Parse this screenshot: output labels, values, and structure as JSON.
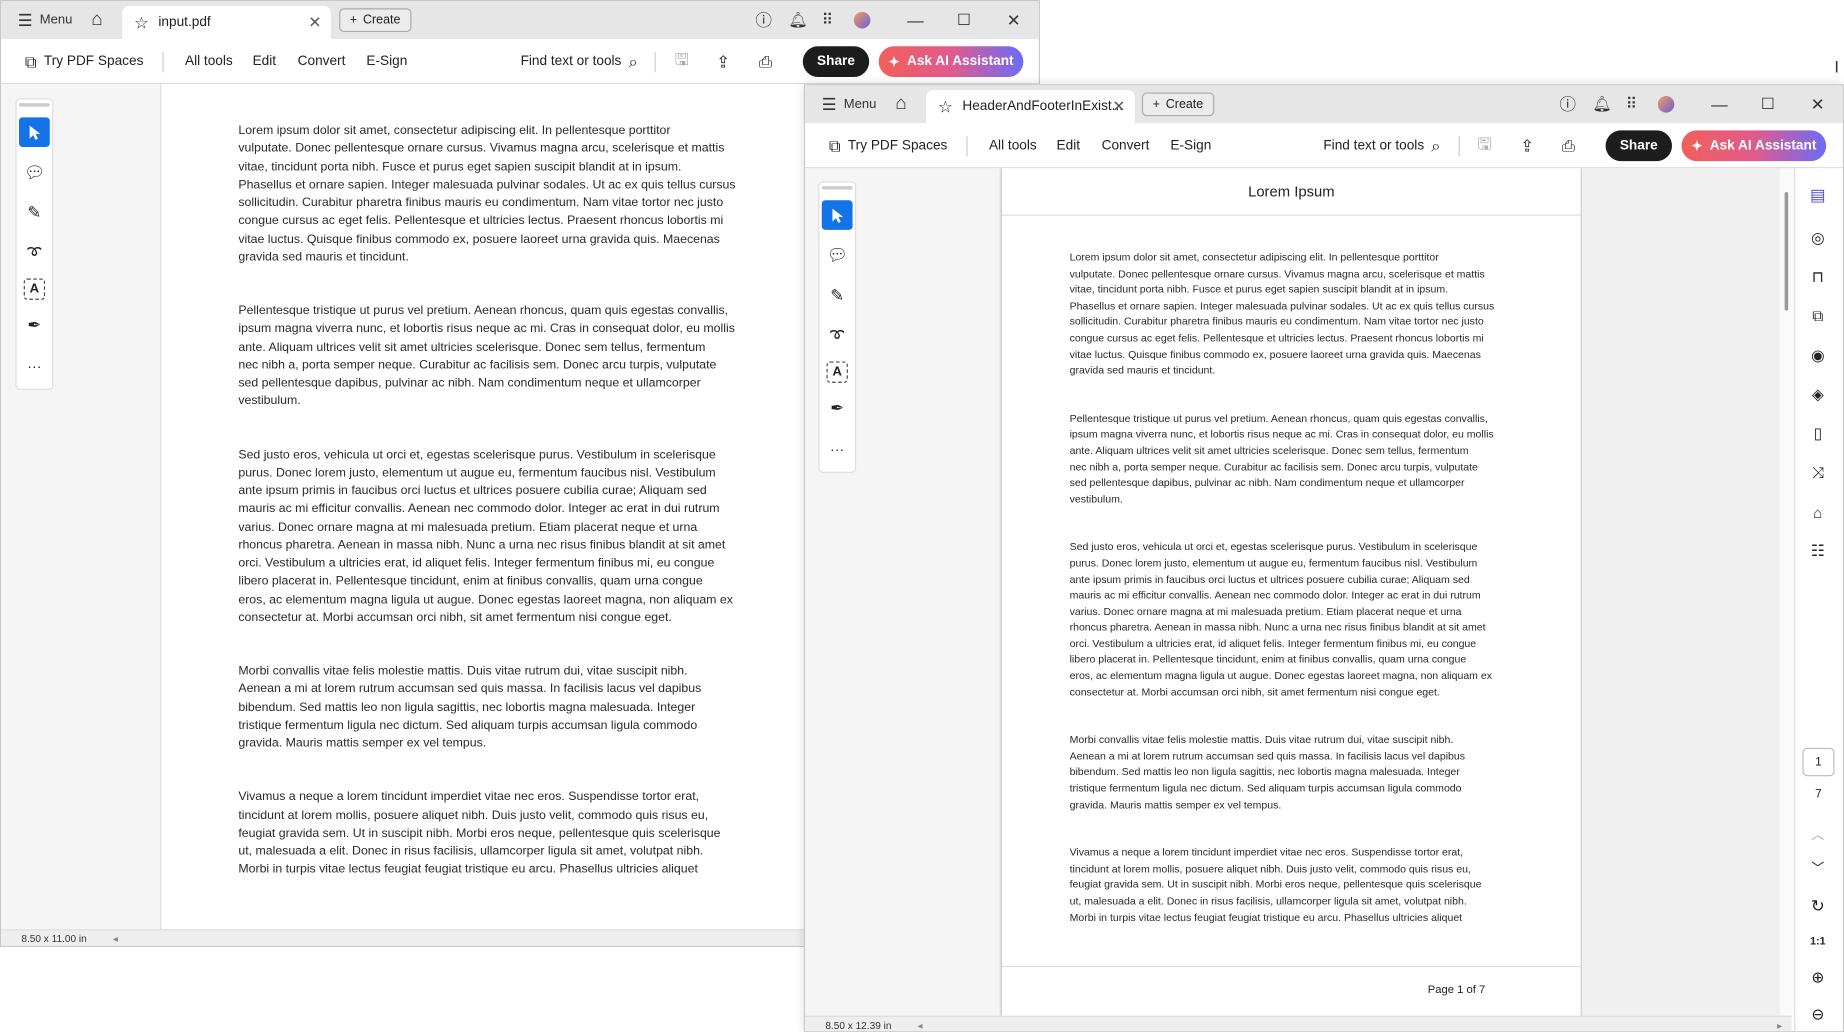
{
  "window1": {
    "menu_label": "Menu",
    "tab_title": "input.pdf",
    "create_label": "Create",
    "toolbar": {
      "try_spaces": "Try PDF Spaces",
      "all_tools": "All tools",
      "edit": "Edit",
      "convert": "Convert",
      "esign": "E-Sign",
      "find": "Find text or tools",
      "share": "Share",
      "ai": "Ask AI Assistant"
    },
    "page_size": "8.50 x 11.00 in"
  },
  "window2": {
    "menu_label": "Menu",
    "tab_title": "HeaderAndFooterInExist...",
    "create_label": "Create",
    "toolbar": {
      "try_spaces": "Try PDF Spaces",
      "all_tools": "All tools",
      "edit": "Edit",
      "convert": "Convert",
      "esign": "E-Sign",
      "find": "Find text or tools",
      "share": "Share",
      "ai": "Ask AI Assistant"
    },
    "page_header": "Lorem Ipsum",
    "page_footer": "Page 1 of 7",
    "current_page": "1",
    "total_pages": "7",
    "page_size": "8.50 x 12.39 in"
  },
  "colors": {
    "accent": "#1473e6",
    "ai_gradient_start": "#f0605a",
    "ai_gradient_end": "#6b6cf6",
    "share_bg": "#1d1d1d"
  },
  "document": {
    "paragraphs": [
      [
        "Lorem ipsum dolor sit amet, consectetur adipiscing elit. In pellentesque porttitor",
        "vulputate. Donec pellentesque ornare cursus. Vivamus magna arcu, scelerisque et mattis",
        "vitae, tincidunt porta nibh. Fusce et purus eget sapien suscipit blandit at in ipsum.",
        "Phasellus et ornare sapien. Integer malesuada pulvinar sodales. Ut ac ex quis tellus cursus",
        "sollicitudin. Curabitur pharetra finibus mauris eu condimentum. Nam vitae tortor nec justo",
        "congue cursus ac eget felis. Pellentesque et ultricies lectus. Praesent rhoncus lobortis mi",
        "vitae luctus. Quisque finibus commodo ex, posuere laoreet urna gravida quis. Maecenas",
        "gravida sed mauris et tincidunt."
      ],
      [
        "Pellentesque tristique ut purus vel pretium. Aenean rhoncus, quam quis egestas convallis,",
        "ipsum magna viverra nunc, et lobortis risus neque ac mi. Cras in consequat dolor, eu mollis",
        "ante. Aliquam ultrices velit sit amet ultricies scelerisque. Donec sem tellus, fermentum",
        "nec nibh a, porta semper neque. Curabitur ac facilisis sem. Donec arcu turpis, vulputate",
        "sed pellentesque dapibus, pulvinar ac nibh. Nam condimentum neque et ullamcorper",
        "vestibulum."
      ],
      [
        "Sed justo eros, vehicula ut orci et, egestas scelerisque purus. Vestibulum in scelerisque",
        "purus. Donec lorem justo, elementum ut augue eu, fermentum faucibus nisl. Vestibulum",
        "ante ipsum primis in faucibus orci luctus et ultrices posuere cubilia curae; Aliquam sed",
        "mauris ac mi efficitur convallis. Aenean nec commodo dolor. Integer ac erat in dui rutrum",
        "varius. Donec ornare magna at mi malesuada pretium. Etiam placerat neque et urna",
        "rhoncus pharetra. Aenean in massa nibh. Nunc a urna nec risus finibus blandit at sit amet",
        "orci. Vestibulum a ultricies erat, id aliquet felis. Integer fermentum finibus mi, eu congue",
        "libero placerat in. Pellentesque tincidunt, enim at finibus convallis, quam urna congue",
        "eros, ac elementum magna ligula ut augue. Donec egestas laoreet magna, non aliquam ex",
        "consectetur at. Morbi accumsan orci nibh, sit amet fermentum nisi congue eget."
      ],
      [
        "Morbi convallis vitae felis molestie mattis. Duis vitae rutrum dui, vitae suscipit nibh.",
        "Aenean a mi at lorem rutrum accumsan sed quis massa. In facilisis lacus vel dapibus",
        "bibendum. Sed mattis leo non ligula sagittis, nec lobortis magna malesuada. Integer",
        "tristique fermentum ligula nec dictum. Sed aliquam turpis accumsan ligula commodo",
        "gravida. Mauris mattis semper ex vel tempus."
      ],
      [
        "Vivamus a neque a lorem tincidunt imperdiet vitae nec eros. Suspendisse tortor erat,",
        "tincidunt at lorem mollis, posuere aliquet nibh. Duis justo velit, commodo quis risus eu,",
        "feugiat gravida sem. Ut in suscipit nibh. Morbi eros neque, pellentesque quis scelerisque",
        "ut, malesuada a elit. Donec in risus facilisis, ullamcorper ligula sit amet, volutpat nibh.",
        "Morbi in turpis vitae lectus feugiat feugiat tristique eu arcu. Phasellus ultricies aliquet"
      ]
    ]
  }
}
